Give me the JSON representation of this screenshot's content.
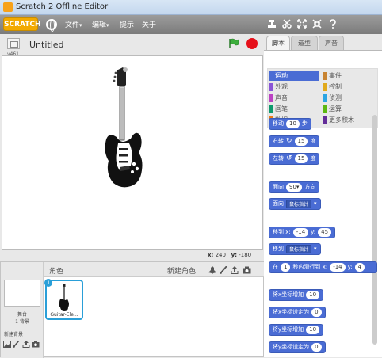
{
  "window": {
    "title": "Scratch 2 Offline Editor"
  },
  "menubar": {
    "logo": "SCRATCH",
    "menus": [
      "文件",
      "编辑",
      "提示",
      "关于"
    ],
    "dropdown_arrow": "▾"
  },
  "stage_header": {
    "version": "v461",
    "project_title": "Untitled"
  },
  "stage": {
    "coord_x_label": "x:",
    "coord_x": "240",
    "coord_y_label": "y:",
    "coord_y": "-180"
  },
  "sprites": {
    "header_label": "角色",
    "new_sprite_label": "新建角色:",
    "stage_label": "舞台",
    "stage_backdrops": "1 背景",
    "new_backdrop_label": "新建背景",
    "items": [
      {
        "name": "Guitar-Ele..."
      }
    ]
  },
  "tabs": [
    "脚本",
    "造型",
    "声音"
  ],
  "categories": [
    {
      "label": "运动",
      "color": "#4a6cd4",
      "selected": true
    },
    {
      "label": "事件",
      "color": "#c88330"
    },
    {
      "label": "外观",
      "color": "#8a55d7"
    },
    {
      "label": "控制",
      "color": "#e1a91a"
    },
    {
      "label": "声音",
      "color": "#bb42c3"
    },
    {
      "label": "侦测",
      "color": "#2ca5e2"
    },
    {
      "label": "画笔",
      "color": "#0e9a6c"
    },
    {
      "label": "运算",
      "color": "#5cb712"
    },
    {
      "label": "数据",
      "color": "#ee7d16"
    },
    {
      "label": "更多积木",
      "color": "#632d99"
    }
  ],
  "blocks": {
    "move": {
      "label": "移动",
      "value": "10",
      "suffix": "步"
    },
    "turn_right": {
      "label": "右转",
      "icon": "↻",
      "value": "15",
      "suffix": "度"
    },
    "turn_left": {
      "label": "左转",
      "icon": "↺",
      "value": "15",
      "suffix": "度"
    },
    "point_dir": {
      "label": "面向",
      "value": "90▾",
      "suffix": "方向"
    },
    "point_towards": {
      "label": "面向",
      "menu": "鼠标指针"
    },
    "goto_xy": {
      "label": "移到 x:",
      "x": "-14",
      "ylabel": "y:",
      "y": "45"
    },
    "goto": {
      "label": "移到",
      "menu": "鼠标指针"
    },
    "glide": {
      "prefix": "在",
      "value": "1",
      "mid": "秒内滑行到 x:",
      "x": "-14",
      "ylabel": "y:",
      "y": "4"
    },
    "change_x": {
      "label": "将x坐标增加",
      "value": "10"
    },
    "set_x": {
      "label": "将x坐标设定为",
      "value": "0"
    },
    "change_y": {
      "label": "将y坐标增加",
      "value": "10"
    },
    "set_y": {
      "label": "将y坐标设定为",
      "value": "0"
    }
  }
}
